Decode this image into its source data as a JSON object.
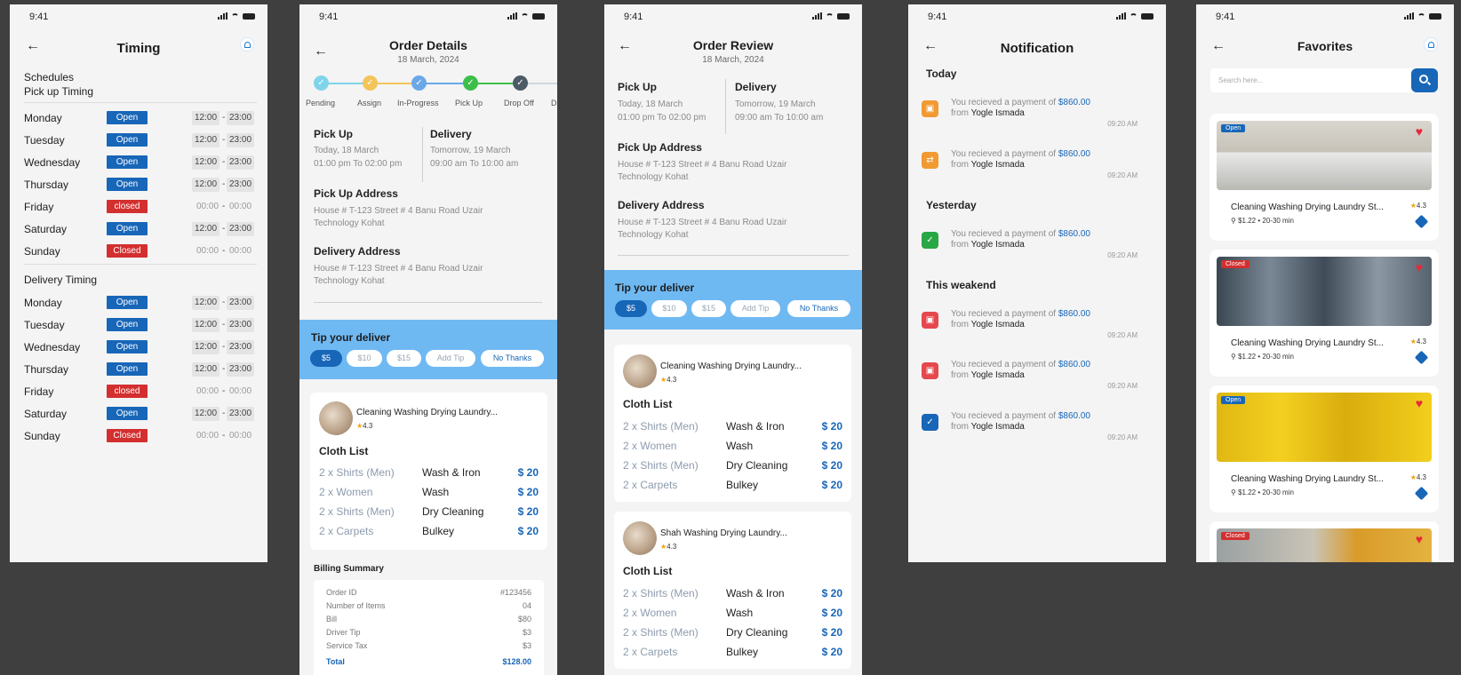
{
  "status_time": "9:41",
  "timing": {
    "title": "Timing",
    "schedules_label": "Schedules",
    "pickup_label": "Pick up Timing",
    "delivery_label": "Delivery Timing",
    "dash": "-",
    "pickup": [
      {
        "day": "Monday",
        "status": "Open",
        "from": "12:00",
        "to": "23:00"
      },
      {
        "day": "Tuesday",
        "status": "Open",
        "from": "12:00",
        "to": "23:00"
      },
      {
        "day": "Wednesday",
        "status": "Open",
        "from": "12:00",
        "to": "23:00"
      },
      {
        "day": "Thursday",
        "status": "Open",
        "from": "12:00",
        "to": "23:00"
      },
      {
        "day": "Friday",
        "status": "closed",
        "from": "00:00",
        "to": "00:00"
      },
      {
        "day": "Saturday",
        "status": "Open",
        "from": "12:00",
        "to": "23:00"
      },
      {
        "day": "Sunday",
        "status": "Closed",
        "from": "00:00",
        "to": "00:00"
      }
    ],
    "delivery": [
      {
        "day": "Monday",
        "status": "Open",
        "from": "12:00",
        "to": "23:00"
      },
      {
        "day": "Tuesday",
        "status": "Open",
        "from": "12:00",
        "to": "23:00"
      },
      {
        "day": "Wednesday",
        "status": "Open",
        "from": "12:00",
        "to": "23:00"
      },
      {
        "day": "Thursday",
        "status": "Open",
        "from": "12:00",
        "to": "23:00"
      },
      {
        "day": "Friday",
        "status": "closed",
        "from": "00:00",
        "to": "00:00"
      },
      {
        "day": "Saturday",
        "status": "Open",
        "from": "12:00",
        "to": "23:00"
      },
      {
        "day": "Sunday",
        "status": "Closed",
        "from": "00:00",
        "to": "00:00"
      }
    ]
  },
  "order_details": {
    "title": "Order Details",
    "date": "18 March, 2024",
    "steps": [
      "Pending",
      "Assign",
      "In-Progress",
      "Pick Up",
      "Drop Off",
      "D"
    ],
    "pickup_label": "Pick Up",
    "pickup_date": "Today, 18 March",
    "pickup_time": "01:00 pm To 02:00 pm",
    "delivery_label": "Delivery",
    "delivery_date": "Tomorrow, 19 March",
    "delivery_time": "09:00 am To 10:00 am",
    "pickup_address_label": "Pick Up Address",
    "pickup_address": "House # T-123 Street # 4 Banu Road Uzair Technology Kohat",
    "delivery_address_label": "Delivery Address",
    "delivery_address": "House # T-123 Street # 4 Banu Road Uzair Technology Kohat",
    "tip_title": "Tip your deliver",
    "tips": [
      "$5",
      "$10",
      "$15",
      "Add Tip",
      "No Thanks"
    ],
    "shop_name": "Cleaning Washing Drying Laundry...",
    "shop_rating": "4.3",
    "cloth_list_title": "Cloth List",
    "cloth_items": [
      {
        "qty": "2 x Shirts (Men)",
        "service": "Wash & Iron",
        "price": "$ 20"
      },
      {
        "qty": "2 x Women",
        "service": "Wash",
        "price": "$ 20"
      },
      {
        "qty": "2 x Shirts (Men)",
        "service": "Dry Cleaning",
        "price": "$ 20"
      },
      {
        "qty": "2 x Carpets",
        "service": "Bulkey",
        "price": "$ 20"
      }
    ],
    "billing_title": "Billing Summary",
    "billing": [
      {
        "label": "Order ID",
        "value": "#123456"
      },
      {
        "label": "Number of Items",
        "value": "04"
      },
      {
        "label": "Bill",
        "value": "$80"
      },
      {
        "label": "Driver Tip",
        "value": "$3"
      },
      {
        "label": "Service Tax",
        "value": "$3"
      }
    ],
    "total_label": "Total",
    "total_value": "$128.00"
  },
  "order_review": {
    "title": "Order Review",
    "date": "18 March, 2024",
    "pickup_label": "Pick Up",
    "pickup_date": "Today, 18 March",
    "pickup_time": "01:00 pm To 02:00 pm",
    "delivery_label": "Delivery",
    "delivery_date": "Tomorrow, 19 March",
    "delivery_time": "09:00 am To 10:00 am",
    "pickup_address_label": "Pick Up Address",
    "pickup_address": "House # T-123 Street # 4 Banu Road Uzair Technology Kohat",
    "delivery_address_label": "Delivery Address",
    "delivery_address": "House # T-123 Street # 4 Banu Road Uzair Technology Kohat",
    "tip_title": "Tip your deliver",
    "tips": [
      "$5",
      "$10",
      "$15",
      "Add Tip",
      "No Thanks"
    ],
    "cards": [
      {
        "shop_name": "Cleaning Washing Drying Laundry...",
        "rating": "4.3",
        "cloth_list_title": "Cloth List",
        "items": [
          {
            "qty": "2 x Shirts (Men)",
            "service": "Wash & Iron",
            "price": "$ 20"
          },
          {
            "qty": "2 x Women",
            "service": "Wash",
            "price": "$ 20"
          },
          {
            "qty": "2 x Shirts (Men)",
            "service": "Dry Cleaning",
            "price": "$ 20"
          },
          {
            "qty": "2 x Carpets",
            "service": "Bulkey",
            "price": "$ 20"
          }
        ]
      },
      {
        "shop_name": "Shah Washing Drying Laundry...",
        "rating": "4.3",
        "cloth_list_title": "Cloth List",
        "items": [
          {
            "qty": "2 x Shirts (Men)",
            "service": "Wash & Iron",
            "price": "$ 20"
          },
          {
            "qty": "2 x Women",
            "service": "Wash",
            "price": "$ 20"
          },
          {
            "qty": "2 x Shirts (Men)",
            "service": "Dry Cleaning",
            "price": "$ 20"
          },
          {
            "qty": "2 x Carpets",
            "service": "Bulkey",
            "price": "$ 20"
          }
        ]
      }
    ]
  },
  "notifications": {
    "title": "Notification",
    "groups": [
      {
        "label": "Today",
        "items": [
          {
            "text": "You recieved a payment of",
            "amount": "$860.00",
            "from": "from",
            "who": "Yogle Ismada",
            "time": "09:20 AM",
            "icon": "box-icon",
            "color": "#f29a32"
          },
          {
            "text": "You recieved a payment of",
            "amount": "$860.00",
            "from": "from",
            "who": "Yogle Ismada",
            "time": "09:20 AM",
            "icon": "delivery-icon",
            "color": "#f29a32"
          }
        ]
      },
      {
        "label": "Yesterday",
        "items": [
          {
            "text": "You recieved a payment of",
            "amount": "$860.00",
            "from": "from",
            "who": "Yogle Ismada",
            "time": "09:20 AM",
            "icon": "check-icon",
            "color": "#28a745"
          }
        ]
      },
      {
        "label": "This weakend",
        "items": [
          {
            "text": "You recieved a payment of",
            "amount": "$860.00",
            "from": "from",
            "who": "Yogle Ismada",
            "time": "09:20 AM",
            "icon": "box-icon",
            "color": "#e5484d"
          },
          {
            "text": "You recieved a payment of",
            "amount": "$860.00",
            "from": "from",
            "who": "Yogle Ismada",
            "time": "09:20 AM",
            "icon": "box-icon",
            "color": "#e5484d"
          },
          {
            "text": "You recieved a payment of",
            "amount": "$860.00",
            "from": "from",
            "who": "Yogle Ismada",
            "time": "09:20 AM",
            "icon": "verified-icon",
            "color": "#1866b8"
          }
        ]
      }
    ]
  },
  "favorites": {
    "title": "Favorites",
    "search_placeholder": "Search here...",
    "cards": [
      {
        "badge": "Open",
        "name": "Cleaning Washing Drying Laundry St...",
        "rating": "4.3",
        "price": "$1.22",
        "eta": "20-30 min",
        "img": "laundry-room"
      },
      {
        "badge": "Closed",
        "name": "Cleaning Washing Drying Laundry St...",
        "rating": "4.3",
        "price": "$1.22",
        "eta": "20-30 min",
        "img": "laundromat"
      },
      {
        "badge": "Open",
        "name": "Cleaning Washing Drying Laundry St...",
        "rating": "4.3",
        "price": "$1.22",
        "eta": "20-30 min",
        "img": "yellow-machines"
      },
      {
        "badge": "Closed",
        "name": "",
        "rating": "",
        "price": "",
        "eta": "",
        "img": "washer-towels"
      }
    ]
  }
}
